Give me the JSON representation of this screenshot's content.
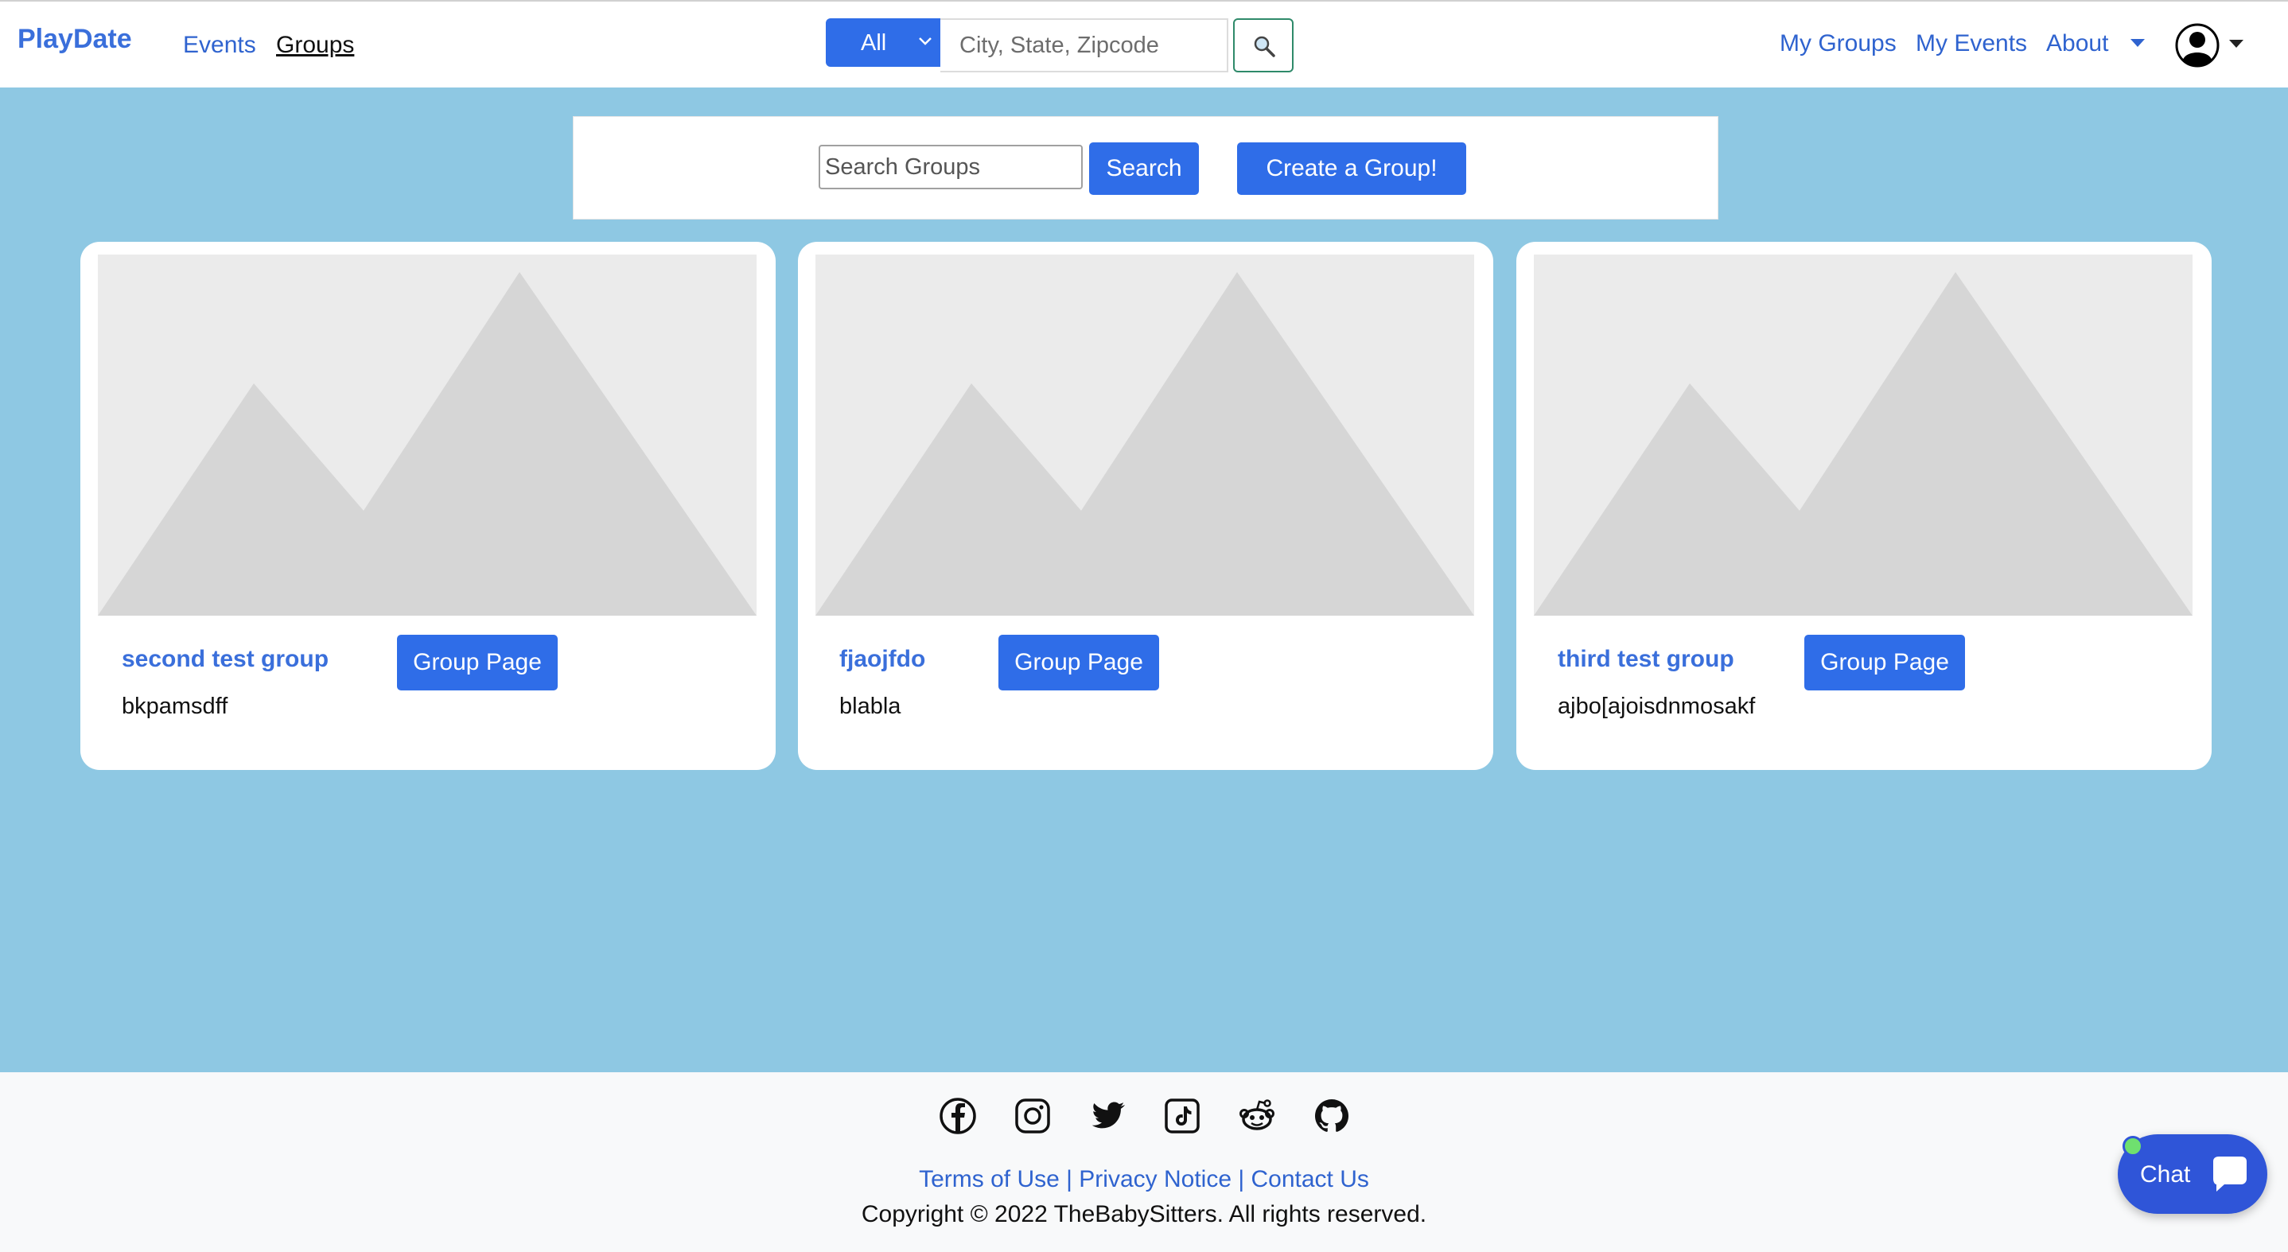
{
  "navbar": {
    "brand": "PlayDate",
    "links": [
      {
        "label": "Events",
        "active": false
      },
      {
        "label": "Groups",
        "active": true
      }
    ],
    "scope_select": "All",
    "location_placeholder": "City, State, Zipcode",
    "right_links": [
      "My Groups",
      "My Events",
      "About"
    ]
  },
  "search_panel": {
    "groups_placeholder": "Search Groups",
    "search_label": "Search",
    "create_label": "Create a Group!"
  },
  "groups": [
    {
      "name": "second test group",
      "description": "bkpamsdff",
      "button": "Group Page"
    },
    {
      "name": "fjaojfdo",
      "description": "blabla",
      "button": "Group Page"
    },
    {
      "name": "third test group",
      "description": "ajbo[ajoisdnmosakf",
      "button": "Group Page"
    }
  ],
  "footer": {
    "social_icons": [
      "facebook-icon",
      "instagram-icon",
      "twitter-icon",
      "tiktok-icon",
      "reddit-icon",
      "github-icon"
    ],
    "links_text": "Terms of Use | Privacy Notice | Contact Us",
    "copyright": "Copyright © 2022 TheBabySitters. All rights reserved."
  },
  "chat": {
    "label": "Chat"
  },
  "colors": {
    "page_bg": "#8ec8e3",
    "primary": "#2f6de8",
    "link": "#2f63cf",
    "chat_bg": "#2f55d8",
    "online": "#6fe06f"
  }
}
